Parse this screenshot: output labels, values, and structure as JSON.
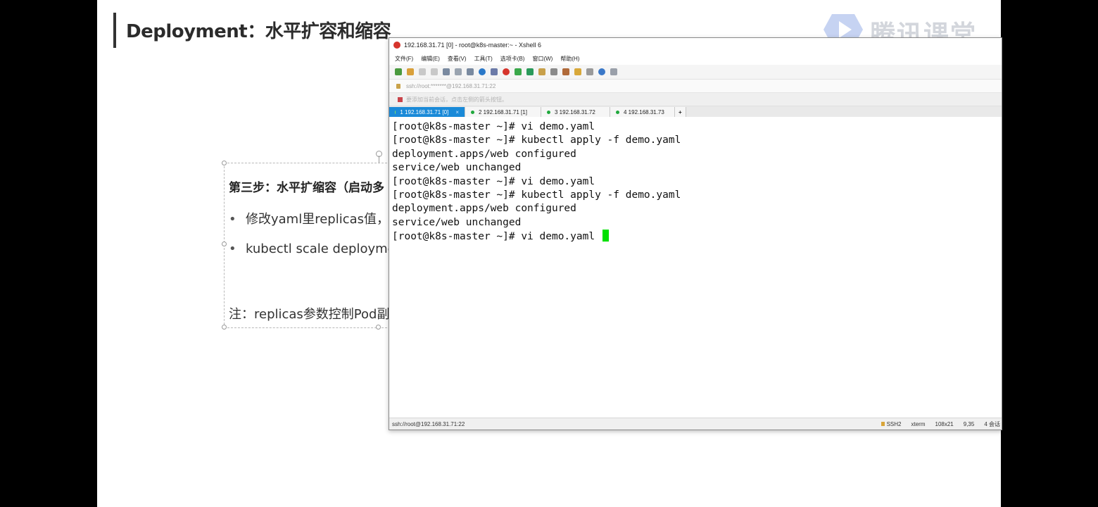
{
  "slide": {
    "title": "Deployment：水平扩容和缩容",
    "logo_text": "腾讯课堂",
    "textbox": {
      "heading": "第三步：水平扩缩容（启动多",
      "bullets": [
        "修改yaml里replicas值，再",
        "kubectl scale deployment"
      ],
      "bullet_glyph": "•",
      "note": "注：replicas参数控制Pod副本"
    }
  },
  "xshell": {
    "title": "192.168.31.71 [0] - root@k8s-master:~ - Xshell 6",
    "menu": [
      "文件(F)",
      "编辑(E)",
      "查看(V)",
      "工具(T)",
      "选项卡(B)",
      "窗口(W)",
      "帮助(H)"
    ],
    "address": "ssh://root:*******@192.168.31.71:22",
    "hint": "要添加当前会话，点击左侧的箭头按钮。",
    "tabs": [
      {
        "label": "1 192.168.31.71 [0]",
        "active": true,
        "close": "×"
      },
      {
        "label": "2 192.168.31.71 [1]",
        "active": false
      },
      {
        "label": "3 192.168.31.72",
        "active": false
      },
      {
        "label": "4 192.168.31.73",
        "active": false
      }
    ],
    "add_tab": "+",
    "terminal_lines": [
      "[root@k8s-master ~]# vi demo.yaml",
      "[root@k8s-master ~]# kubectl apply -f demo.yaml",
      "deployment.apps/web configured",
      "service/web unchanged",
      "[root@k8s-master ~]# vi demo.yaml",
      "[root@k8s-master ~]# kubectl apply -f demo.yaml",
      "deployment.apps/web configured",
      "service/web unchanged",
      "[root@k8s-master ~]# vi demo.yaml "
    ],
    "status": {
      "connection": "ssh://root@192.168.31.71:22",
      "protocol": "SSH2",
      "term": "xterm",
      "size": "108x21",
      "cursor_pos": "9,35",
      "sessions": "4 会话"
    },
    "colors": {
      "tab_active": "#1a8ad8",
      "cursor": "#00e000"
    }
  }
}
